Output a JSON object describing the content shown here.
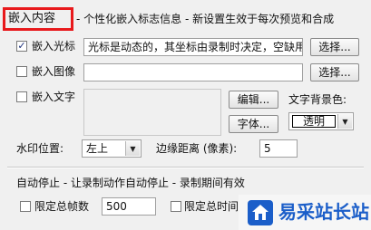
{
  "embed_section": {
    "tab_label": "嵌入内容",
    "description": "- 个性化嵌入标志信息 - 新设置生效于每次预览和合成"
  },
  "embed_cursor": {
    "label": "嵌入光标",
    "checked": true,
    "value": "光标是动态的，其坐标由录制时决定，空缺用",
    "browse_label": "选择..."
  },
  "embed_image": {
    "label": "嵌入图像",
    "checked": false,
    "value": "",
    "browse_label": "选择..."
  },
  "embed_text": {
    "label": "嵌入文字",
    "checked": false,
    "value": "",
    "edit_label": "编辑...",
    "font_label": "字体...",
    "bg_color_label": "文字背景色:",
    "bg_color_value": "透明"
  },
  "watermark": {
    "position_label": "水印位置:",
    "position_value": "左上",
    "margin_label": "边缘距离 (像素):",
    "margin_value": "5"
  },
  "auto_stop": {
    "title": "自动停止 - 让录制动作自动停止 - 录制期间有效",
    "limit_frames_label": "限定总帧数",
    "limit_frames_checked": false,
    "frames_value": "500",
    "limit_time_label": "限定总时间",
    "limit_time_checked": false
  },
  "watermark_logo": {
    "text": "易采站长站"
  },
  "colors": {
    "highlight_box": "#e8191c",
    "logo_blue": "#1b5ec9"
  }
}
